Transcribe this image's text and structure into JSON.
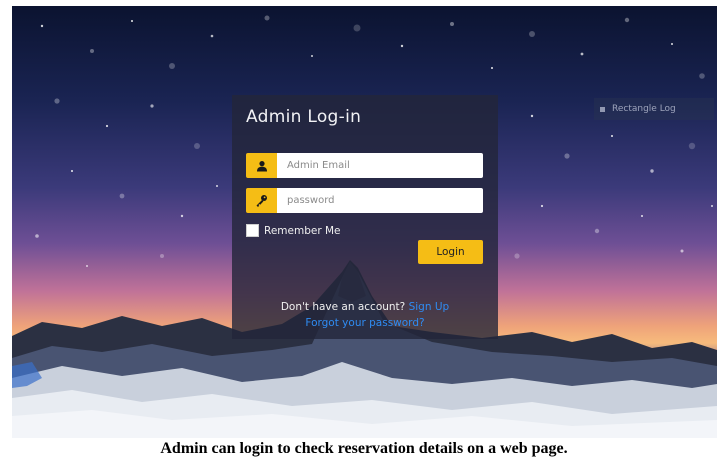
{
  "login": {
    "title": "Admin Log-in",
    "email_placeholder": "Admin Email",
    "password_placeholder": "password",
    "remember_label": "Remember Me",
    "login_button": "Login",
    "no_account_text": "Don't have an account?",
    "signup_link": "Sign Up",
    "forgot_link": "Forgot your password?"
  },
  "background_badge": {
    "label": "Rectangle Log"
  },
  "icons": {
    "email": "user-icon",
    "password": "key-icon"
  },
  "colors": {
    "accent": "#f5bd15",
    "link": "#2f8cf3",
    "panel": "#23263a"
  },
  "caption": "Admin can login to check reservation details on a web page."
}
